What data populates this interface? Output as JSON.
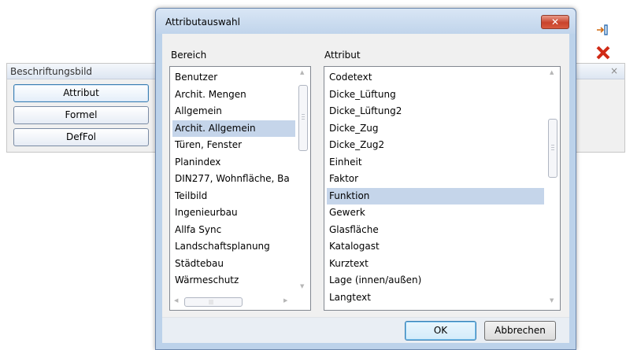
{
  "background_palette": {
    "title": "Beschriftungsbild",
    "close_glyph": "×",
    "buttons": [
      {
        "label": "Attribut"
      },
      {
        "label": "Formel"
      },
      {
        "label": "DefFol"
      }
    ],
    "icons": [
      "insert-icon",
      "delete-x-icon"
    ]
  },
  "dialog": {
    "title": "Attributauswahl",
    "close_glyph": "✕",
    "bereich": {
      "label": "Bereich",
      "items": [
        "Benutzer",
        "Archit. Mengen",
        "Allgemein",
        "Archit. Allgemein",
        "Türen, Fenster",
        "Planindex",
        "DIN277, Wohnfläche, Ba",
        "Teilbild",
        "Ingenieurbau",
        "Allfa Sync",
        "Landschaftsplanung",
        "Städtebau",
        "Wärmeschutz"
      ],
      "selected": "Archit. Allgemein"
    },
    "attribut": {
      "label": "Attribut",
      "items": [
        "Codetext",
        "Dicke_Lüftung",
        "Dicke_Lüftung2",
        "Dicke_Zug",
        "Dicke_Zug2",
        "Einheit",
        "Faktor",
        "Funktion",
        "Gewerk",
        "Glasfläche",
        "Katalogast",
        "Kurztext",
        "Lage (innen/außen)",
        "Langtext"
      ],
      "selected": "Funktion"
    },
    "ok_label": "OK",
    "cancel_label": "Abbrechen"
  },
  "colors": {
    "selection": "#c5d5ea",
    "close_red": "#c9432b",
    "dialog_frame": "#bcd2ea"
  }
}
